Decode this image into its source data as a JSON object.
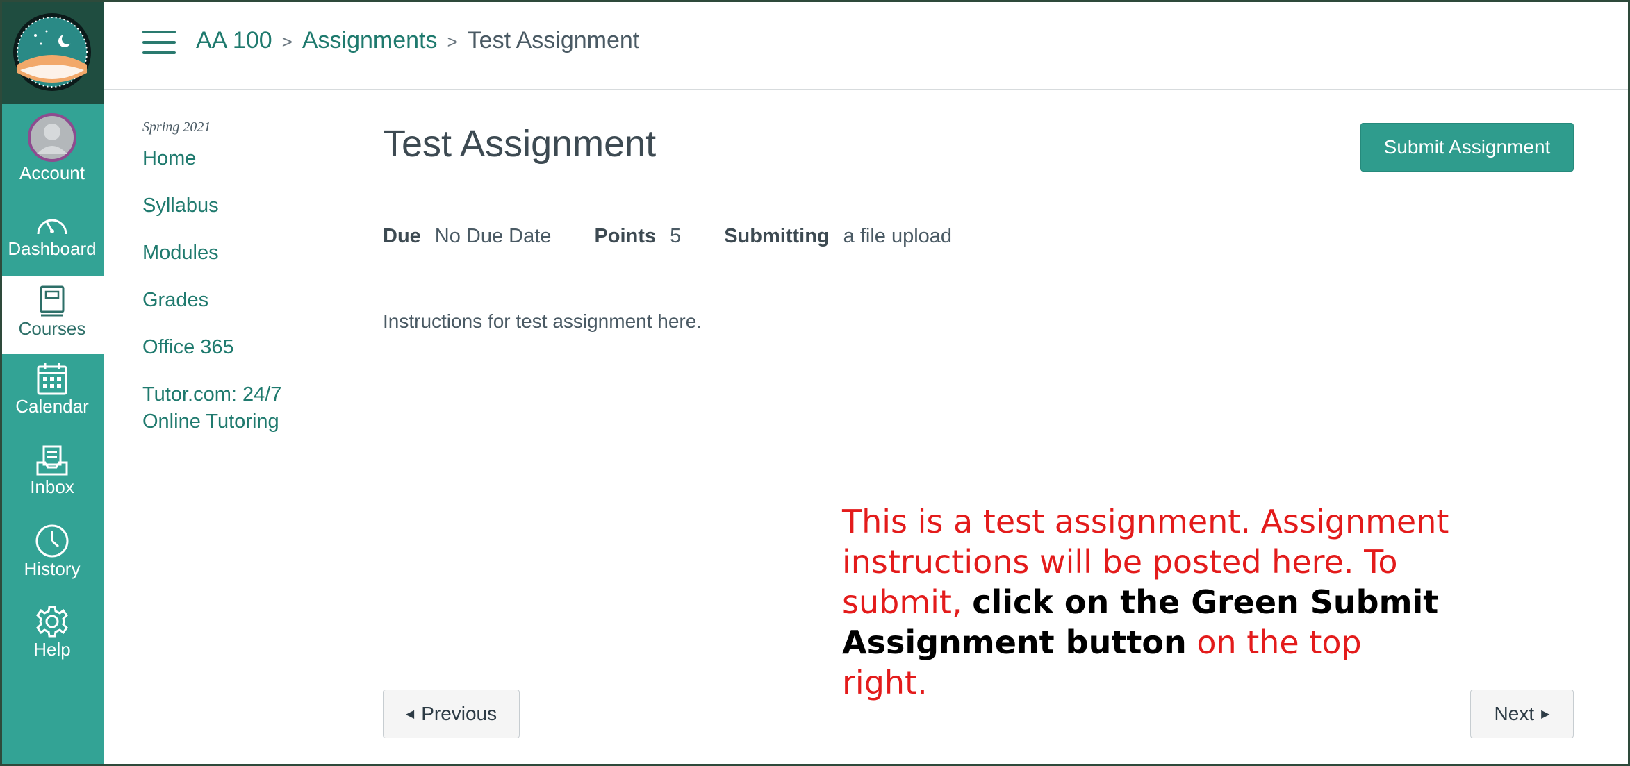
{
  "nav": {
    "items": [
      {
        "label": "Account",
        "icon": "avatar"
      },
      {
        "label": "Dashboard",
        "icon": "dashboard-icon"
      },
      {
        "label": "Courses",
        "icon": "courses-icon"
      },
      {
        "label": "Calendar",
        "icon": "calendar-icon"
      },
      {
        "label": "Inbox",
        "icon": "inbox-icon"
      },
      {
        "label": "History",
        "icon": "history-icon"
      },
      {
        "label": "Help",
        "icon": "help-icon"
      }
    ],
    "active": "Courses"
  },
  "breadcrumb": {
    "course": "AA 100",
    "section": "Assignments",
    "current": "Test Assignment",
    "separator": ">"
  },
  "course_nav": {
    "term": "Spring 2021",
    "links": [
      "Home",
      "Syllabus",
      "Modules",
      "Grades",
      "Office 365",
      "Tutor.com: 24/7",
      "Online Tutoring"
    ]
  },
  "assignment": {
    "title": "Test Assignment",
    "submit_label": "Submit Assignment",
    "due_label": "Due",
    "due_value": "No Due Date",
    "points_label": "Points",
    "points_value": "5",
    "submitting_label": "Submitting",
    "submitting_value": "a file upload",
    "instructions": "Instructions for test assignment here."
  },
  "annotation": {
    "part1": "This is a test assignment. Assignment instructions will be posted here. To submit, ",
    "bold": "click on the Green Submit Assignment button",
    "part2": " on the top right."
  },
  "pager": {
    "previous": "Previous",
    "next": "Next"
  },
  "colors": {
    "nav_bg": "#33a395",
    "accent": "#2f9c8d",
    "link": "#1f7a6e",
    "annotation_red": "#e31b1b"
  }
}
